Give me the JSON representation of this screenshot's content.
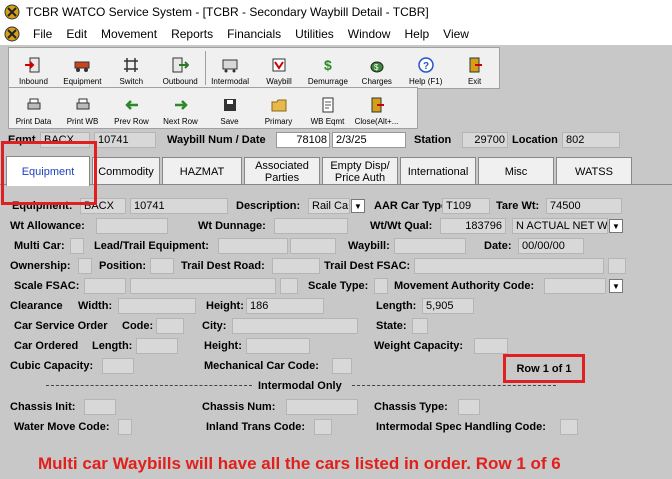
{
  "window": {
    "title": "TCBR WATCO Service System - [TCBR - Secondary Waybill Detail - TCBR]"
  },
  "menu": [
    "File",
    "Edit",
    "Movement",
    "Reports",
    "Financials",
    "Utilities",
    "Window",
    "Help",
    "View"
  ],
  "toolbar1": [
    {
      "label": "Inbound",
      "icon": "inbound-icon"
    },
    {
      "label": "Equipment",
      "icon": "equipment-icon"
    },
    {
      "label": "Switch",
      "icon": "switch-icon"
    },
    {
      "label": "Outbound",
      "icon": "outbound-icon"
    },
    {
      "label": "Intermodal",
      "icon": "intermodal-icon"
    },
    {
      "label": "Waybill",
      "icon": "waybill-icon"
    },
    {
      "label": "Demurrage",
      "icon": "demurrage-icon"
    },
    {
      "label": "Charges",
      "icon": "charges-icon"
    },
    {
      "label": "Help (F1)",
      "icon": "help-icon"
    },
    {
      "label": "Exit",
      "icon": "exit-icon"
    }
  ],
  "toolbar2": [
    {
      "label": "Print Data",
      "icon": "print-data-icon"
    },
    {
      "label": "Print WB",
      "icon": "print-wb-icon"
    },
    {
      "label": "Prev Row",
      "icon": "prev-row-icon"
    },
    {
      "label": "Next Row",
      "icon": "next-row-icon"
    },
    {
      "label": "Save",
      "icon": "save-icon"
    },
    {
      "label": "Primary",
      "icon": "primary-icon"
    },
    {
      "label": "WB Eqmt",
      "icon": "wb-eqmt-icon"
    },
    {
      "label": "Close(Alt+...",
      "icon": "close-icon"
    }
  ],
  "header": {
    "eqmt_label": "Eqmt",
    "eqmt_init": "BACX",
    "eqmt_num": "10741",
    "waybill_label": "Waybill Num / Date",
    "waybill_num": "78108",
    "waybill_date": "2/3/25",
    "station_label": "Station",
    "station_value": "29700",
    "location_label": "Location",
    "location_value": "802"
  },
  "tabs": [
    "Equipment",
    "Commodity",
    "HAZMAT",
    "Associated Parties",
    "Empty Disp/ Price Auth",
    "International",
    "Misc",
    "WATSS"
  ],
  "form": {
    "equipment_label": "Equipment:",
    "equipment_init": "BACX",
    "equipment_num": "10741",
    "description_label": "Description:",
    "description_value": "Rail Ca",
    "aar_label": "AAR Car Type:",
    "aar_value": "T109",
    "tare_label": "Tare Wt:",
    "tare_value": "74500",
    "wt_allowance_label": "Wt Allowance:",
    "wt_dunnage_label": "Wt Dunnage:",
    "wt_qual_label": "Wt/Wt Qual:",
    "wt_value": "183796",
    "wt_qual_value": "N ACTUAL NET W",
    "multi_car_label": "Multi Car:",
    "lead_trail_label": "Lead/Trail Equipment:",
    "waybill_label": "Waybill:",
    "date_label": "Date:",
    "date_value": "00/00/00",
    "ownership_label": "Ownership:",
    "position_label": "Position:",
    "trail_dest_road_label": "Trail Dest Road:",
    "trail_dest_fsac_label": "Trail Dest FSAC:",
    "scale_fsac_label": "Scale  FSAC:",
    "scale_type_label": "Scale Type:",
    "movement_auth_label": "Movement Authority Code:",
    "clearance_label": "Clearance",
    "width_label": "Width:",
    "height_label": "Height:",
    "height_value": "186",
    "length_label": "Length:",
    "length_value": "5,905",
    "car_service_label": "Car Service Order",
    "code_label": "Code:",
    "city_label": "City:",
    "state_label": "State:",
    "car_ordered_label": "Car Ordered",
    "c_length_label": "Length:",
    "c_height_label": "Height:",
    "weight_capacity_label": "Weight Capacity:",
    "cubic_label": "Cubic Capacity:",
    "mech_label": "Mechanical Car Code:",
    "row_count": "Row 1 of 1",
    "intermodal_title": "Intermodal Only",
    "chassis_init_label": "Chassis Init:",
    "chassis_num_label": "Chassis Num:",
    "chassis_type_label": "Chassis Type:",
    "water_label": "Water Move Code:",
    "inland_label": "Inland Trans Code:",
    "spec_label": "Intermodal Spec Handling Code:"
  },
  "annotation": "Multi car Waybills will have all the cars listed in order. Row 1 of 6",
  "colors": {
    "annotation": "#e0201c",
    "active_tab_text": "#1f3fbf"
  }
}
